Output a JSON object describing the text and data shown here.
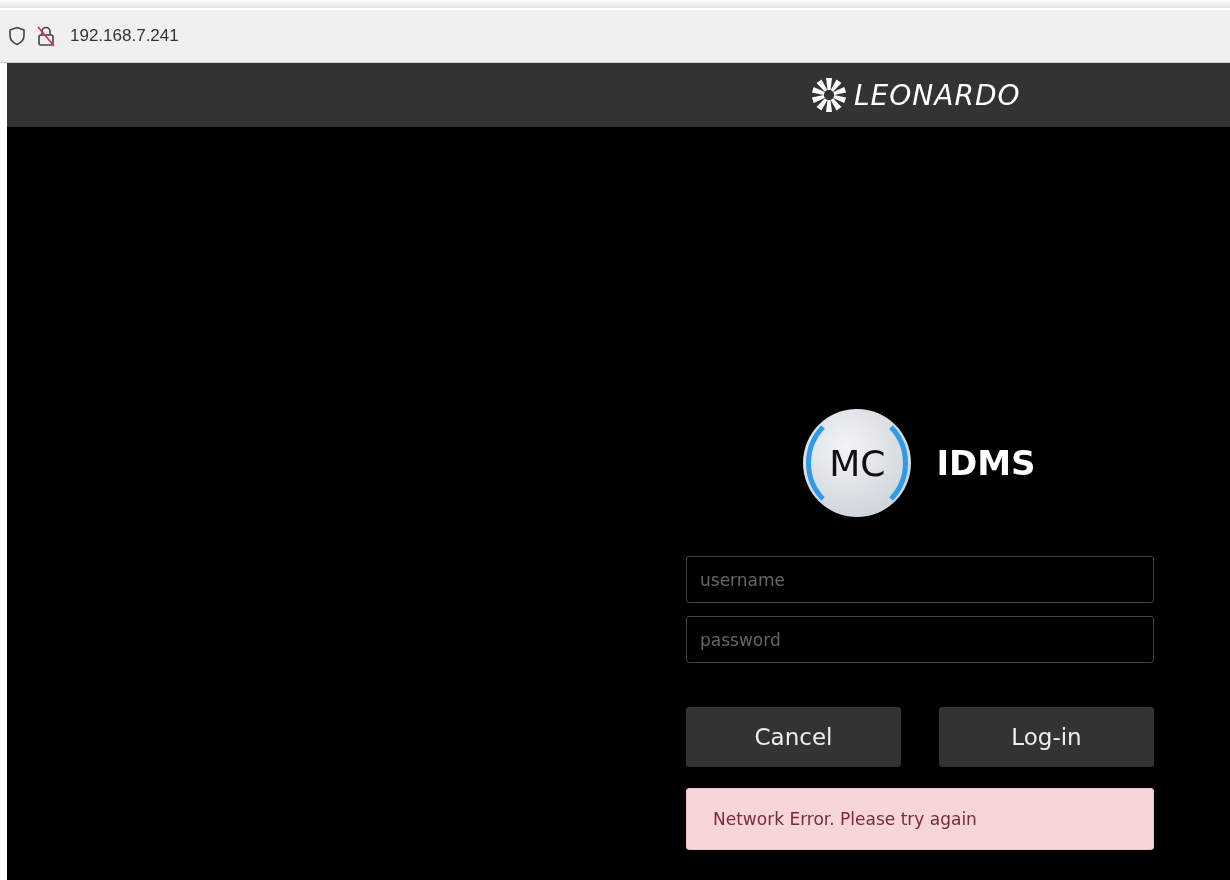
{
  "browser": {
    "url": "192.168.7.241"
  },
  "header": {
    "brand": "LEONARDO"
  },
  "login": {
    "badge": "MC",
    "app_name": "IDMS",
    "username": {
      "placeholder": "username"
    },
    "password": {
      "placeholder": "password"
    },
    "buttons": [
      {
        "label": "Cancel"
      },
      {
        "label": "Log-in"
      }
    ],
    "error": "Network Error. Please try again"
  }
}
